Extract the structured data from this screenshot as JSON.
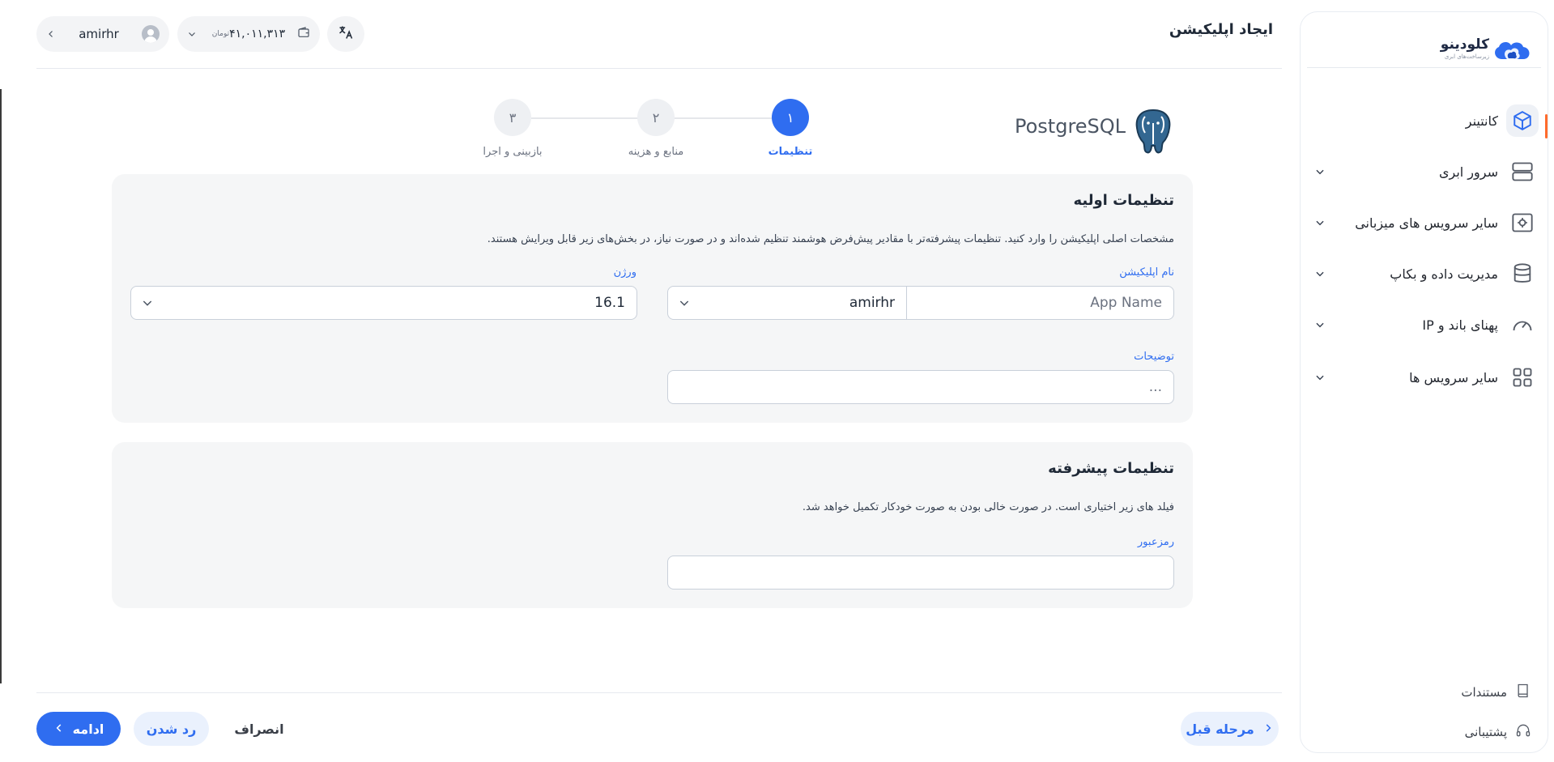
{
  "sidebar": {
    "logo": {
      "name": "کلودینو",
      "tagline": "زیرساخت‌های ابری"
    },
    "items": [
      {
        "label": "کانتینر",
        "icon": "cube-icon",
        "active": true
      },
      {
        "label": "سرور ابری",
        "icon": "server-icon"
      },
      {
        "label": "سایر سرویس های میزبانی",
        "icon": "server-gear-icon"
      },
      {
        "label": "مدیریت داده و بکاپ",
        "icon": "database-icon"
      },
      {
        "label": "پهنای باند و IP",
        "icon": "speedometer-icon"
      },
      {
        "label": "سایر سرویس ها",
        "icon": "grid-icon"
      }
    ],
    "footer": [
      {
        "label": "مستندات",
        "icon": "book-icon"
      },
      {
        "label": "پشتیبانی",
        "icon": "headset-icon"
      }
    ]
  },
  "header": {
    "title": "ایجاد اپلیکیشن",
    "user": "amirhr",
    "wallet_amount": "۴۱,۰۱۱,۳۱۳",
    "wallet_unit": "تومان"
  },
  "app": {
    "name": "PostgreSQL"
  },
  "stepper": [
    {
      "num": "۱",
      "label": "تنظیمات",
      "active": true
    },
    {
      "num": "۲",
      "label": "منابع و هزینه"
    },
    {
      "num": "۳",
      "label": "بازبینی و اجرا"
    }
  ],
  "basic": {
    "title": "تنظیمات اولیه",
    "desc": "مشخصات اصلی اپلیکیشن را وارد کنید. تنظیمات پیشرفته‌تر با مقادیر پیش‌فرض هوشمند تنظیم شده‌اند و در صورت نیاز، در بخش‌های زیر قابل ویرایش هستند.",
    "app_name_label": "نام اپلیکیشن",
    "app_name_placeholder": "App Name",
    "owner_value": "amirhr",
    "version_label": "ورژن",
    "version_value": "16.1",
    "desc_label": "توضیحات",
    "desc_placeholder": "..."
  },
  "advanced": {
    "title": "تنظیمات پیشرفته",
    "desc": "فیلد های زیر اختیاری است. در صورت خالی بودن به صورت خودکار تکمیل خواهد شد.",
    "password_label": "رمزعبور",
    "password_value": ""
  },
  "footer": {
    "prev": "مرحله قبل",
    "continue": "ادامه",
    "skip": "رد شدن",
    "cancel": "انصراف"
  },
  "colors": {
    "accent": "#2f6df0",
    "active_bar": "#ff6b2c",
    "card_bg": "#f5f6f7"
  }
}
